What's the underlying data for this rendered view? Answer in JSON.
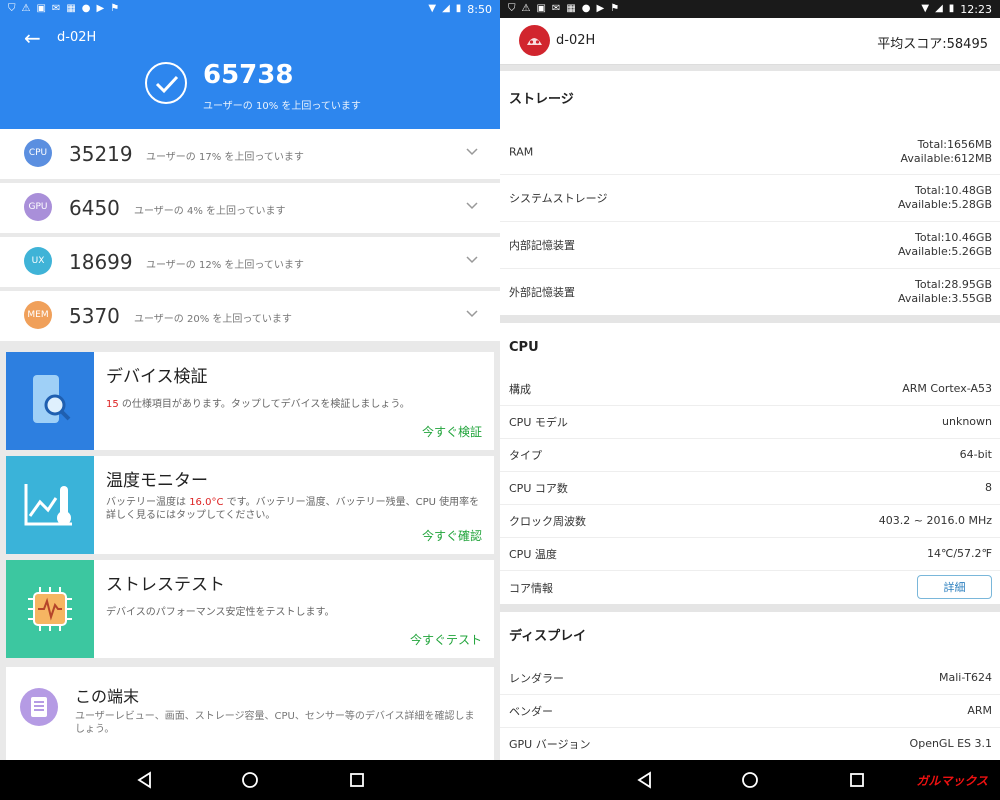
{
  "left": {
    "status": {
      "time": "8:50"
    },
    "header": {
      "device": "d-02H",
      "score": "65738",
      "subtitle": "ユーザーの 10% を上回っています"
    },
    "categories": [
      {
        "badge": "CPU",
        "value": "35219",
        "pct": "ユーザーの 17% を上回っています",
        "color": "#5b8fe0"
      },
      {
        "badge": "GPU",
        "value": "6450",
        "pct": "ユーザーの 4% を上回っています",
        "color": "#a98fd9"
      },
      {
        "badge": "UX",
        "value": "18699",
        "pct": "ユーザーの 12% を上回っています",
        "color": "#3fb3d7"
      },
      {
        "badge": "MEM",
        "value": "5370",
        "pct": "ユーザーの 20% を上回っています",
        "color": "#f0a05a"
      }
    ],
    "cards": [
      {
        "title": "デバイス検証",
        "desc_num": "15",
        "desc": " の仕様項目があります。タップしてデバイスを検証しましょう。",
        "action": "今すぐ検証",
        "color": "#2d7fe0"
      },
      {
        "title": "温度モニター",
        "desc_pre": "バッテリー温度は ",
        "desc_num": "16.0°C",
        "desc": " です。バッテリー温度、バッテリー残量、CPU 使用率を詳しく見るにはタップしてください。",
        "action": "今すぐ確認",
        "color": "#3ab3d9"
      },
      {
        "title": "ストレステスト",
        "desc": "デバイスのパフォーマンス安定性をテストします。",
        "action": "今すぐテスト",
        "color": "#3cc7a0"
      }
    ],
    "device_card": {
      "title": "この端末",
      "desc": "ユーザーレビュー、画面、ストレージ容量、CPU、センサー等のデバイス詳細を確認しましょう。"
    }
  },
  "right": {
    "status": {
      "time": "12:23"
    },
    "header": {
      "device": "d-02H",
      "avg": "平均スコア:58495"
    },
    "storage": {
      "title": "ストレージ",
      "rows": [
        {
          "k": "RAM",
          "v1": "Total:1656MB",
          "v2": "Available:612MB"
        },
        {
          "k": "システムストレージ",
          "v1": "Total:10.48GB",
          "v2": "Available:5.28GB"
        },
        {
          "k": "内部記憶装置",
          "v1": "Total:10.46GB",
          "v2": "Available:5.26GB"
        },
        {
          "k": "外部記憶装置",
          "v1": "Total:28.95GB",
          "v2": "Available:3.55GB"
        }
      ]
    },
    "cpu": {
      "title": "CPU",
      "rows": [
        {
          "k": "構成",
          "v": "ARM Cortex-A53"
        },
        {
          "k": "CPU モデル",
          "v": "unknown"
        },
        {
          "k": "タイプ",
          "v": "64-bit"
        },
        {
          "k": "CPU コア数",
          "v": "8"
        },
        {
          "k": "クロック周波数",
          "v": "403.2 ~ 2016.0 MHz"
        },
        {
          "k": "CPU 温度",
          "v": "14℃/57.2℉"
        }
      ],
      "core_label": "コア情報",
      "core_button": "詳細"
    },
    "display": {
      "title": "ディスプレイ",
      "rows": [
        {
          "k": "レンダラー",
          "v": "Mali-T624"
        },
        {
          "k": "ベンダー",
          "v": "ARM"
        },
        {
          "k": "GPU バージョン",
          "v": "OpenGL ES 3.1"
        }
      ]
    }
  },
  "watermark": "ガルマックス"
}
